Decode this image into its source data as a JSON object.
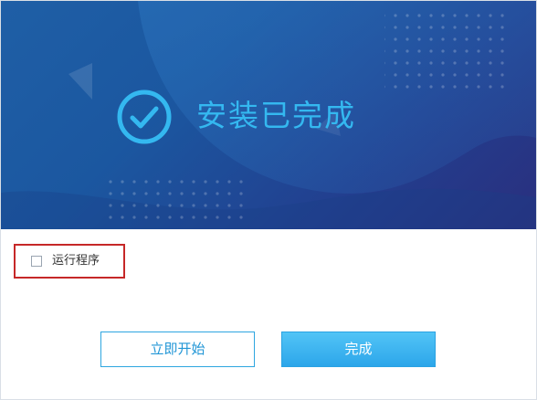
{
  "window": {
    "title": "安装已完成"
  },
  "banner": {
    "title": "安装已完成",
    "icon": "check-circle-icon",
    "accent": "#34b8f0"
  },
  "options": {
    "run_program_label": "运行程序",
    "run_program_checked": false,
    "highlight_color": "#c62828"
  },
  "buttons": {
    "start_now": "立即开始",
    "finish": "完成"
  }
}
